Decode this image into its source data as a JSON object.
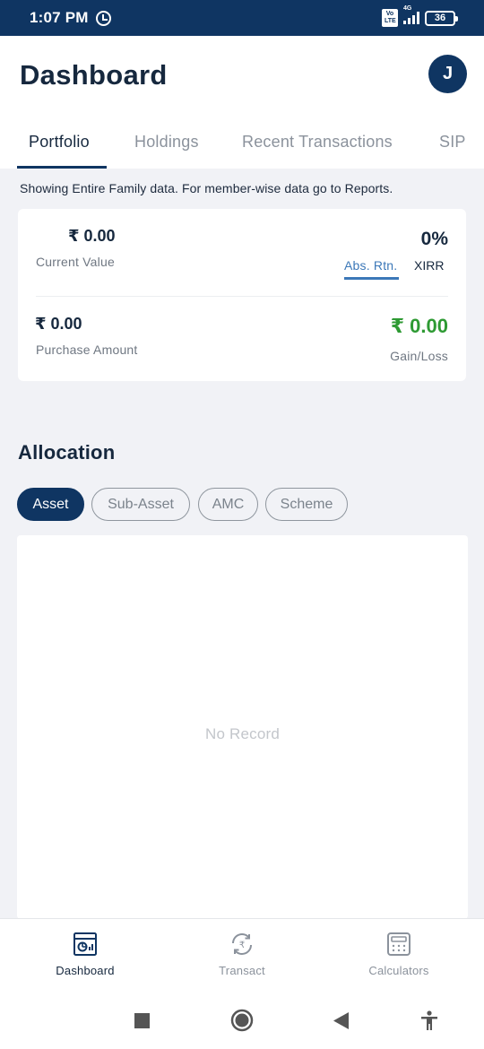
{
  "status_bar": {
    "time": "1:07 PM",
    "alarm_icon": "alarm-icon",
    "volte_label": "Vo LTE",
    "network_label": "4G",
    "battery_level": "36"
  },
  "header": {
    "title": "Dashboard",
    "avatar_initial": "J"
  },
  "tabs": [
    {
      "label": "Portfolio",
      "active": true
    },
    {
      "label": "Holdings",
      "active": false
    },
    {
      "label": "Recent Transactions",
      "active": false
    },
    {
      "label": "SIP",
      "active": false
    }
  ],
  "family_note": "Showing Entire Family data. For member-wise data go to Reports.",
  "summary": {
    "current_value": "₹ 0.00",
    "current_value_label": "Current Value",
    "return_value": "0%",
    "return_tabs": [
      "Abs. Rtn.",
      "XIRR"
    ],
    "purchase_amount": "₹ 0.00",
    "purchase_amount_label": "Purchase Amount",
    "gain_loss": "₹ 0.00",
    "gain_loss_label": "Gain/Loss",
    "gain_color": "#2e9a33",
    "accent_color": "#3c78b8"
  },
  "allocation": {
    "title": "Allocation",
    "chips": [
      {
        "label": "Asset",
        "active": true
      },
      {
        "label": "Sub-Asset",
        "active": false
      },
      {
        "label": "AMC",
        "active": false
      },
      {
        "label": "Scheme",
        "active": false
      }
    ],
    "empty_text": "No Record"
  },
  "bottom_nav": [
    {
      "label": "Dashboard",
      "icon": "dashboard-icon",
      "active": true
    },
    {
      "label": "Transact",
      "icon": "rupee-exchange-icon",
      "active": false
    },
    {
      "label": "Calculators",
      "icon": "calculator-icon",
      "active": false
    }
  ],
  "system_nav": [
    "recent-apps-icon",
    "home-icon",
    "back-icon",
    "accessibility-icon"
  ],
  "colors": {
    "primary": "#0f3562",
    "background": "#f1f2f6"
  }
}
